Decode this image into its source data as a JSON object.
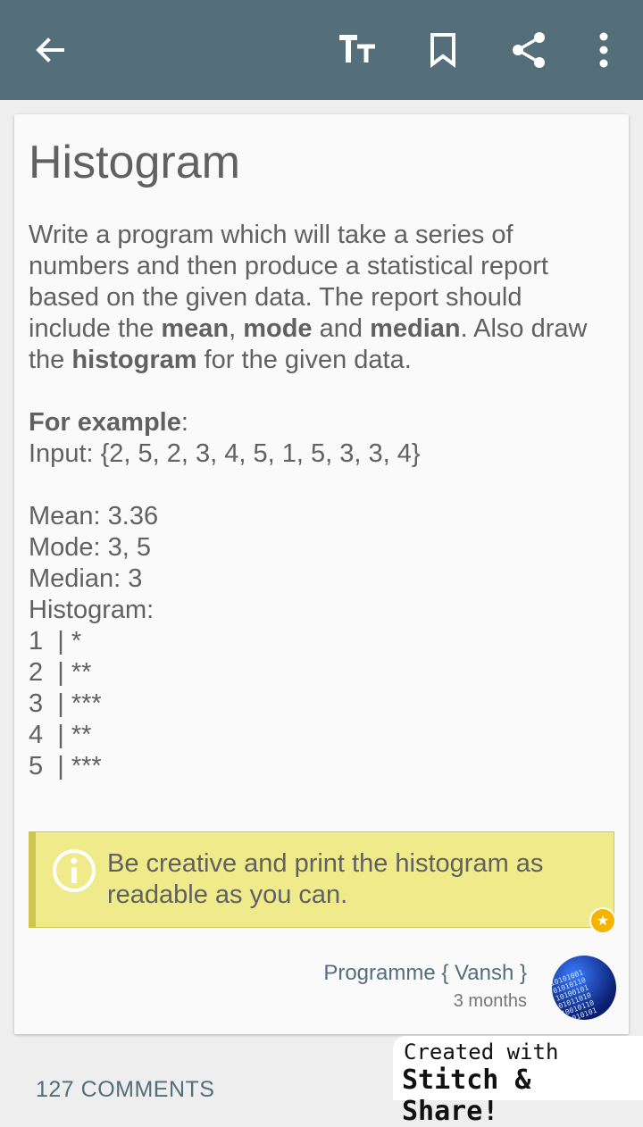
{
  "toolbar": {
    "back_icon": "arrow-left-icon",
    "text_size_icon": "text-size-icon",
    "bookmark_icon": "bookmark-icon",
    "share_icon": "share-icon",
    "more_icon": "more-vertical-icon",
    "background_color": "#546e7a"
  },
  "card": {
    "title": "Histogram",
    "description": {
      "part1": "Write a program which will take a series of numbers and then produce a statistical report based on the given data. The report should include the ",
      "mean": "mean",
      "comma": ", ",
      "mode": "mode",
      "and": " and ",
      "median": "median",
      "part2": ". Also draw the ",
      "histogram": "histogram",
      "part3": " for the given data."
    },
    "example_label": "For example",
    "example_colon": ":",
    "input_line": "Input: {2, 5, 2, 3, 4, 5, 1, 5, 3, 3, 4}",
    "results": [
      "Mean: 3.36",
      "Mode: 3, 5",
      "Median: 3",
      "Histogram:",
      "1  | *",
      "2  | **",
      "3  | ***",
      "4  | **",
      "5  | ***"
    ],
    "info": {
      "icon": "info-icon",
      "message": "Be creative and print the histogram as readable as you can.",
      "background_color": "#efea8a"
    },
    "author": {
      "name": "Programme { Vansh }",
      "time": "3 months",
      "avatar_bits": "10101001 01010110 10100101 01011010 10010110 11010101"
    }
  },
  "comments": {
    "label": "127 COMMENTS"
  },
  "watermark": {
    "line1": "Created with",
    "line2": "Stitch & Share!"
  }
}
